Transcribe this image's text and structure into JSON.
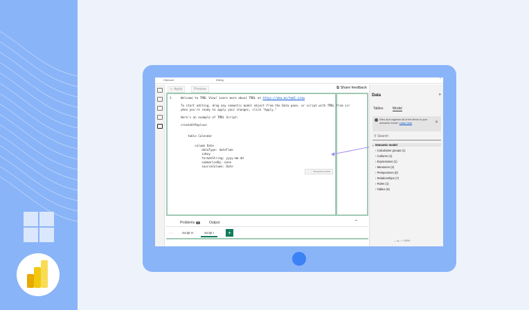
{
  "ribbon": {
    "clipboard": "Clipboard",
    "editing": "Editing"
  },
  "toolbar": {
    "apply": "Apply",
    "preview": "Preview",
    "share_feedback": "Share feedback"
  },
  "editor": {
    "line_number": "1",
    "lines": [
      "Welcome to TMDL View! Learn more about TMDL at ",
      "To start editing, drag any semantic model object from the Data pane, or script with TMDL from scr",
      "when you're ready to apply your changes, click \"Apply.\"",
      "Here's an example of TMDL Script:",
      "createOrReplace",
      "    table Calendar",
      "        column Date",
      "            dataType: dateTime",
      "            isKey",
      "            formatString: yyyy-mm-dd",
      "            summarizeBy: none",
      "            sourceColumn: Date"
    ],
    "link": "https://aka.ms/tmdl-view",
    "drag_tooltip": "Semantic model"
  },
  "bottom": {
    "problems": "Problems",
    "problems_count": "0",
    "output": "Output"
  },
  "scripts": {
    "tab1": "Script H",
    "tab2": "Script I",
    "add": "+"
  },
  "data_pane": {
    "title": "Data",
    "tabs": [
      "Tables",
      "Model"
    ],
    "info": "View and organize all of the items in your semantic model. Learn here",
    "info_link": "Learn here",
    "search_placeholder": "Search",
    "tree": [
      {
        "label": "Semantic model",
        "level": 0,
        "selected": true
      },
      {
        "label": "Calculation groups (1)",
        "level": 1
      },
      {
        "label": "Cultures (1)",
        "level": 1
      },
      {
        "label": "Expressions (1)",
        "level": 1
      },
      {
        "label": "Measures (2)",
        "level": 1
      },
      {
        "label": "Perspectives (0)",
        "level": 1
      },
      {
        "label": "Relationships (7)",
        "level": 1
      },
      {
        "label": "Roles (1)",
        "level": 1
      },
      {
        "label": "Tables (9)",
        "level": 1
      }
    ],
    "zoom": "100%"
  },
  "colors": {
    "background": "#eef3fb",
    "accent": "#8ab4f8",
    "tablet": "#8ab4f8",
    "editor_border": "#9fc9b4",
    "script_green": "#0f7b5c"
  }
}
